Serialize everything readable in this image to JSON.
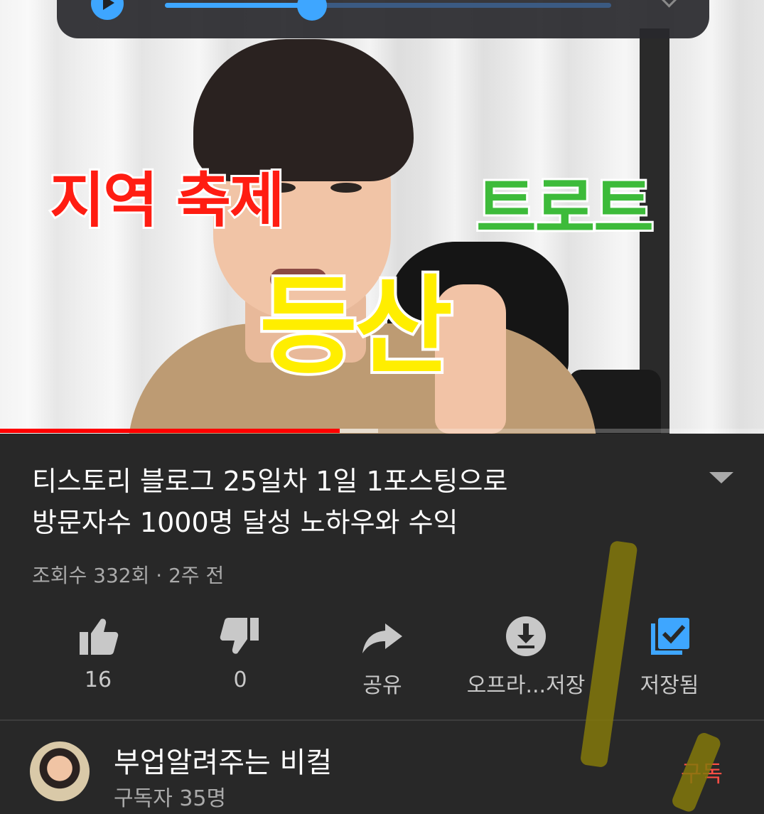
{
  "player": {
    "seek_fraction": 0.33,
    "video_played_fraction": 0.445,
    "video_buffered_fraction": 0.495,
    "overlay_texts": {
      "red": "지역 축제",
      "green": "트로트",
      "yellow": "등산"
    }
  },
  "video": {
    "title_lines": [
      "티스토리 블로그 25일차 1일 1포스팅으로",
      "방문자수 1000명 달성 노하우와 수익"
    ],
    "meta": "조회수 332회 · 2주 전"
  },
  "actions": [
    {
      "id": "like",
      "label": "16",
      "icon": "thumbs-up-icon"
    },
    {
      "id": "dislike",
      "label": "0",
      "icon": "thumbs-down-icon"
    },
    {
      "id": "share",
      "label": "공유",
      "icon": "share-icon"
    },
    {
      "id": "offline",
      "label": "오프라...저장",
      "icon": "download-icon"
    },
    {
      "id": "save",
      "label": "저장됨",
      "icon": "saved-playlist-icon"
    }
  ],
  "channel": {
    "name": "부업알려주는 비컬",
    "subscribers": "구독자 35명",
    "subscribe_label": "구독"
  },
  "colors": {
    "accent_blue": "#3ea6ff",
    "progress_red": "#ff0000",
    "subscribe_red": "#ff4e45",
    "background": "#282828"
  }
}
